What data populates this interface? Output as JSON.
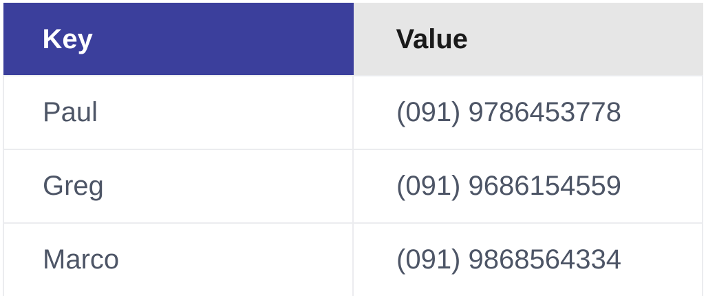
{
  "table": {
    "headers": {
      "key": "Key",
      "value": "Value"
    },
    "rows": [
      {
        "key": "Paul",
        "value": "(091) 9786453778"
      },
      {
        "key": "Greg",
        "value": "(091) 9686154559"
      },
      {
        "key": "Marco",
        "value": "(091) 9868564334"
      }
    ]
  },
  "colors": {
    "key_header_bg": "#3b3f9c",
    "value_header_bg": "#e6e6e6",
    "cell_text": "#4d5566"
  }
}
